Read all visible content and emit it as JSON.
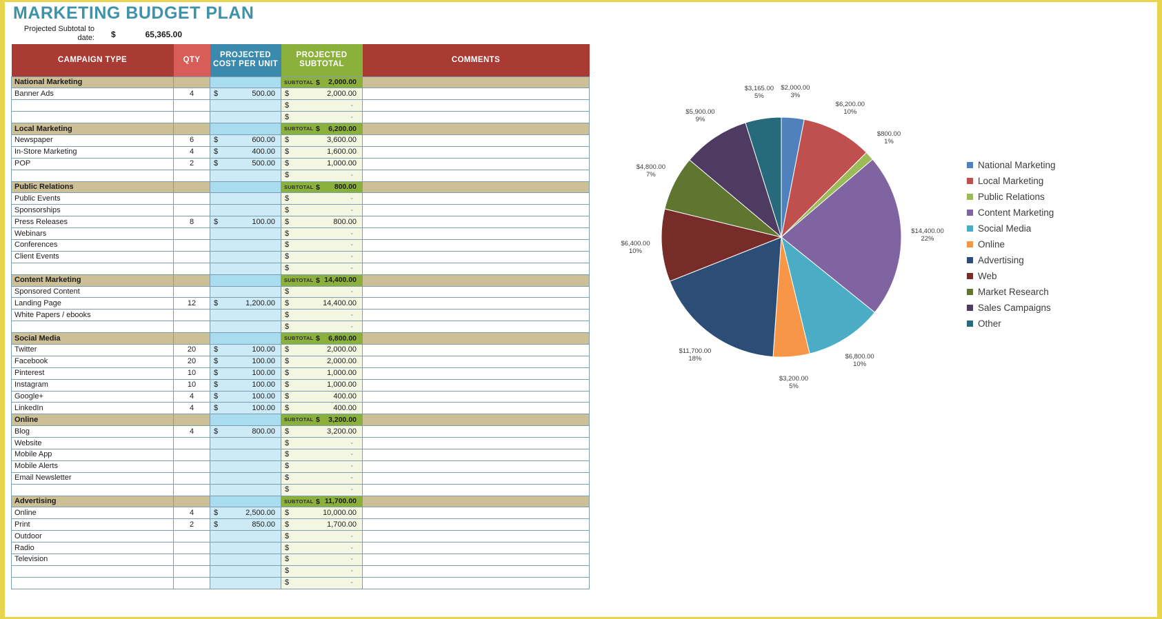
{
  "title": "MARKETING BUDGET PLAN",
  "summary": {
    "label": "Projected Subtotal to date:",
    "currency": "$",
    "value": "65,365.00"
  },
  "table": {
    "headers": {
      "campaign": "CAMPAIGN TYPE",
      "qty": "QTY",
      "cost": "PROJECTED COST PER UNIT",
      "subtotal": "PROJECTED SUBTOTAL",
      "comments": "COMMENTS"
    },
    "subtotal_tag": "SUBTOTAL",
    "currency": "$",
    "dash": "-",
    "groups": [
      {
        "name": "National Marketing",
        "subtotal": "2,000.00",
        "rows": [
          {
            "name": "Banner Ads",
            "qty": "4",
            "cost": "500.00",
            "subtotal": "2,000.00",
            "comment": ""
          },
          {
            "name": "",
            "qty": "",
            "cost": "",
            "subtotal": "",
            "comment": ""
          },
          {
            "name": "",
            "qty": "",
            "cost": "",
            "subtotal": "",
            "comment": ""
          }
        ]
      },
      {
        "name": "Local Marketing",
        "subtotal": "6,200.00",
        "rows": [
          {
            "name": "Newspaper",
            "qty": "6",
            "cost": "600.00",
            "subtotal": "3,600.00",
            "comment": ""
          },
          {
            "name": "In-Store Marketing",
            "qty": "4",
            "cost": "400.00",
            "subtotal": "1,600.00",
            "comment": ""
          },
          {
            "name": "POP",
            "qty": "2",
            "cost": "500.00",
            "subtotal": "1,000.00",
            "comment": ""
          },
          {
            "name": "",
            "qty": "",
            "cost": "",
            "subtotal": "",
            "comment": ""
          }
        ]
      },
      {
        "name": "Public Relations",
        "subtotal": "800.00",
        "rows": [
          {
            "name": "Public Events",
            "qty": "",
            "cost": "",
            "subtotal": "",
            "comment": ""
          },
          {
            "name": "Sponsorships",
            "qty": "",
            "cost": "",
            "subtotal": "",
            "comment": ""
          },
          {
            "name": "Press Releases",
            "qty": "8",
            "cost": "100.00",
            "subtotal": "800.00",
            "comment": ""
          },
          {
            "name": "Webinars",
            "qty": "",
            "cost": "",
            "subtotal": "",
            "comment": ""
          },
          {
            "name": "Conferences",
            "qty": "",
            "cost": "",
            "subtotal": "",
            "comment": ""
          },
          {
            "name": "Client Events",
            "qty": "",
            "cost": "",
            "subtotal": "",
            "comment": ""
          },
          {
            "name": "",
            "qty": "",
            "cost": "",
            "subtotal": "",
            "comment": ""
          }
        ]
      },
      {
        "name": "Content Marketing",
        "subtotal": "14,400.00",
        "rows": [
          {
            "name": "Sponsored Content",
            "qty": "",
            "cost": "",
            "subtotal": "",
            "comment": ""
          },
          {
            "name": "Landing Page",
            "qty": "12",
            "cost": "1,200.00",
            "subtotal": "14,400.00",
            "comment": ""
          },
          {
            "name": "White Papers / ebooks",
            "qty": "",
            "cost": "",
            "subtotal": "",
            "comment": ""
          },
          {
            "name": "",
            "qty": "",
            "cost": "",
            "subtotal": "",
            "comment": ""
          }
        ]
      },
      {
        "name": "Social Media",
        "subtotal": "6,800.00",
        "rows": [
          {
            "name": "Twitter",
            "qty": "20",
            "cost": "100.00",
            "subtotal": "2,000.00",
            "comment": ""
          },
          {
            "name": "Facebook",
            "qty": "20",
            "cost": "100.00",
            "subtotal": "2,000.00",
            "comment": ""
          },
          {
            "name": "Pinterest",
            "qty": "10",
            "cost": "100.00",
            "subtotal": "1,000.00",
            "comment": ""
          },
          {
            "name": "Instagram",
            "qty": "10",
            "cost": "100.00",
            "subtotal": "1,000.00",
            "comment": ""
          },
          {
            "name": "Google+",
            "qty": "4",
            "cost": "100.00",
            "subtotal": "400.00",
            "comment": ""
          },
          {
            "name": "LinkedIn",
            "qty": "4",
            "cost": "100.00",
            "subtotal": "400.00",
            "comment": ""
          }
        ]
      },
      {
        "name": "Online",
        "subtotal": "3,200.00",
        "rows": [
          {
            "name": "Blog",
            "qty": "4",
            "cost": "800.00",
            "subtotal": "3,200.00",
            "comment": ""
          },
          {
            "name": "Website",
            "qty": "",
            "cost": "",
            "subtotal": "",
            "comment": ""
          },
          {
            "name": "Mobile App",
            "qty": "",
            "cost": "",
            "subtotal": "",
            "comment": ""
          },
          {
            "name": "Mobile Alerts",
            "qty": "",
            "cost": "",
            "subtotal": "",
            "comment": ""
          },
          {
            "name": "Email Newsletter",
            "qty": "",
            "cost": "",
            "subtotal": "",
            "comment": ""
          },
          {
            "name": "",
            "qty": "",
            "cost": "",
            "subtotal": "",
            "comment": ""
          }
        ]
      },
      {
        "name": "Advertising",
        "subtotal": "11,700.00",
        "rows": [
          {
            "name": "Online",
            "qty": "4",
            "cost": "2,500.00",
            "subtotal": "10,000.00",
            "comment": ""
          },
          {
            "name": "Print",
            "qty": "2",
            "cost": "850.00",
            "subtotal": "1,700.00",
            "comment": ""
          },
          {
            "name": "Outdoor",
            "qty": "",
            "cost": "",
            "subtotal": "",
            "comment": ""
          },
          {
            "name": "Radio",
            "qty": "",
            "cost": "",
            "subtotal": "",
            "comment": ""
          },
          {
            "name": "Television",
            "qty": "",
            "cost": "",
            "subtotal": "",
            "comment": ""
          },
          {
            "name": "",
            "qty": "",
            "cost": "",
            "subtotal": "",
            "comment": ""
          },
          {
            "name": "",
            "qty": "",
            "cost": "",
            "subtotal": "",
            "comment": ""
          }
        ]
      }
    ]
  },
  "chart_data": {
    "type": "pie",
    "title": "",
    "legend_position": "right",
    "categories": [
      "National Marketing",
      "Local Marketing",
      "Public Relations",
      "Content Marketing",
      "Social Media",
      "Online",
      "Advertising",
      "Web",
      "Market Research",
      "Sales Campaigns",
      "Other"
    ],
    "values": [
      2000,
      6200,
      800,
      14400,
      6800,
      3200,
      11700,
      6400,
      4800,
      5900,
      3165
    ],
    "value_labels": [
      "$2,000.00",
      "$6,200.00",
      "$800.00",
      "$14,400.00",
      "$6,800.00",
      "$3,200.00",
      "$11,700.00",
      "$6,400.00",
      "$4,800.00",
      "$5,900.00",
      "$3,165.00"
    ],
    "percent_labels": [
      "3%",
      "10%",
      "1%",
      "22%",
      "10%",
      "5%",
      "18%",
      "10%",
      "7%",
      "9%",
      "5%"
    ],
    "colors": [
      "#4f81bd",
      "#c0504d",
      "#9bbb59",
      "#8064a2",
      "#4bacc6",
      "#f79646",
      "#2c4d75",
      "#772c2a",
      "#5f7530",
      "#4d3b62",
      "#276a7c"
    ],
    "legend_entries": [
      {
        "label": "National Marketing",
        "color": "#4f81bd"
      },
      {
        "label": "Local Marketing",
        "color": "#c0504d"
      },
      {
        "label": "Public Relations",
        "color": "#9bbb59"
      },
      {
        "label": "Content Marketing",
        "color": "#8064a2"
      },
      {
        "label": "Social Media",
        "color": "#4bacc6"
      },
      {
        "label": "Online",
        "color": "#f79646"
      },
      {
        "label": "Advertising",
        "color": "#2c4d75"
      },
      {
        "label": "Web",
        "color": "#772c2a"
      },
      {
        "label": "Market Research",
        "color": "#5f7530"
      },
      {
        "label": "Sales Campaigns",
        "color": "#4d3b62"
      },
      {
        "label": "Other",
        "color": "#276a7c"
      }
    ]
  }
}
